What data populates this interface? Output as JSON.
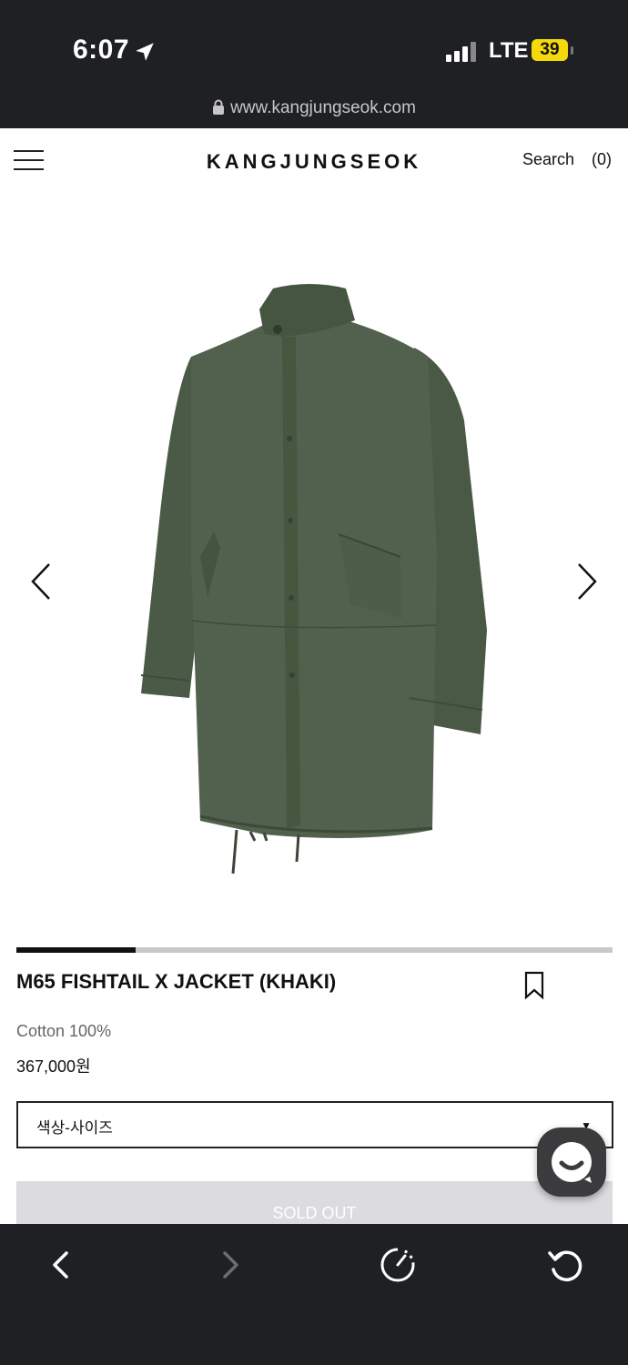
{
  "status_bar": {
    "time": "6:07",
    "network": "LTE",
    "battery": "39",
    "url": "www.kangjungseok.com"
  },
  "header": {
    "brand": "KANGJUNGSEOK",
    "search_label": "Search",
    "cart_label": "(0)"
  },
  "gallery": {
    "progress_fraction": 0.2,
    "image_icon": "khaki-jacket-image"
  },
  "product": {
    "title": "M65 FISHTAIL X JACKET (KHAKI)",
    "material": "Cotton 100%",
    "price": "367,000원",
    "option_select": {
      "value": "색상-사이즈"
    },
    "soldout_label": "SOLD OUT"
  },
  "colors": {
    "jacket": "#4a5a47",
    "dark_bar": "#1f2024",
    "battery": "#f5d90a"
  },
  "icons": [
    "location-arrow-icon",
    "lock-icon",
    "hamburger-icon",
    "arrow-left-icon",
    "arrow-right-icon",
    "bookmark-icon",
    "chat-icon",
    "back-icon",
    "forward-icon",
    "gauge-icon",
    "reload-icon"
  ]
}
